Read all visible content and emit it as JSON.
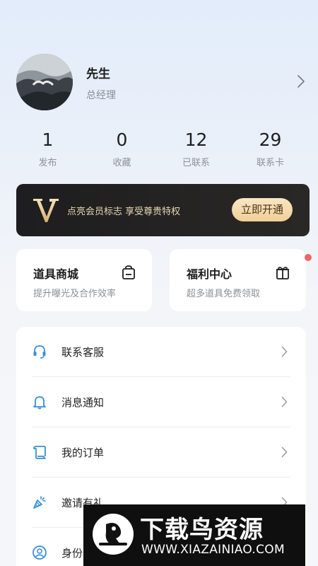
{
  "profile": {
    "name": "先生",
    "title": "总经理",
    "avatar_icon": "avatar-photo",
    "chevron_icon": "chevron-right-icon"
  },
  "stats": [
    {
      "value": "1",
      "label": "发布"
    },
    {
      "value": "0",
      "label": "收藏"
    },
    {
      "value": "12",
      "label": "已联系"
    },
    {
      "value": "29",
      "label": "联系卡"
    }
  ],
  "vip": {
    "logo": "V",
    "text": "点亮会员标志 享受尊贵特权",
    "button": "立即开通",
    "colors": {
      "background": "#1e1d1f",
      "accent": "#f0d098"
    }
  },
  "cards": [
    {
      "title": "道具商城",
      "subtitle": "提升曝光及合作效率",
      "icon": "shopping-bag-icon",
      "badge_dot": false
    },
    {
      "title": "福利中心",
      "subtitle": "超多道具免费领取",
      "icon": "gift-icon",
      "badge_dot": true
    }
  ],
  "menu": [
    {
      "label": "联系客服",
      "icon": "headset-icon"
    },
    {
      "label": "消息通知",
      "icon": "bell-icon"
    },
    {
      "label": "我的订单",
      "icon": "order-scroll-icon"
    },
    {
      "label": "邀请有礼",
      "icon": "party-popper-icon"
    },
    {
      "label": "身份",
      "icon": "user-circle-icon"
    }
  ],
  "watermark": {
    "title": "下载鸟资源",
    "url": "WWW.XIAZAINIAO.COM"
  }
}
